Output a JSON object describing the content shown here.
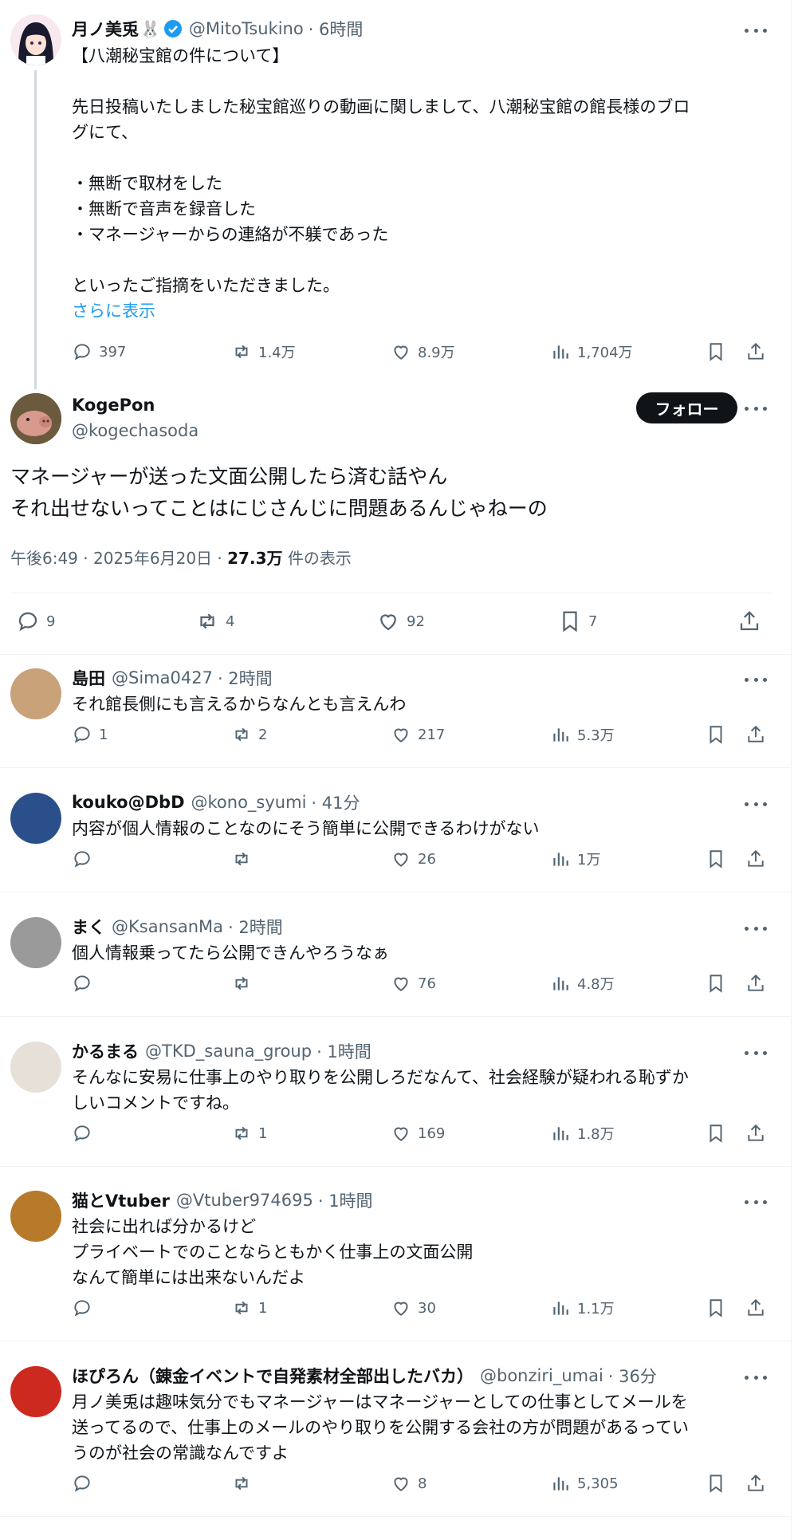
{
  "parent": {
    "name": "月ノ美兎",
    "handle": "@MitoTsukino",
    "time": "· 6時間",
    "lines": [
      "【八潮秘宝館の件について】",
      "",
      "先日投稿いたしました秘宝館巡りの動画に関しまして、八潮秘宝館の館長様のブロ",
      "グにて、",
      "",
      "・無断で取材をした",
      "・無断で音声を録音した",
      "・マネージャーからの連絡が不躾であった",
      "",
      "といったご指摘をいただきました。"
    ],
    "show_more": "さらに表示",
    "stats": {
      "replies": "397",
      "retweets": "1.4万",
      "likes": "8.9万",
      "views": "1,704万"
    }
  },
  "main": {
    "name": "KogePon",
    "handle": "@kogechasoda",
    "follow_label": "フォロー",
    "line1": "マネージャーが送った文面公開したら済む話やん",
    "line2": "それ出せないってことはにじさんじに問題あるんじゃねーの",
    "time": "午後6:49 · 2025年6月20日 · ",
    "views_count": "27.3万",
    "views_label": " 件の表示",
    "stats": {
      "replies": "9",
      "retweets": "4",
      "likes": "92",
      "bookmarks": "7"
    }
  },
  "replies": [
    {
      "name": "島田",
      "handle": "@Sima0427",
      "time": "· 2時間",
      "text": "それ館長側にも言えるからなんとも言えんわ",
      "replies": "1",
      "retweets": "2",
      "likes": "217",
      "views": "5.3万"
    },
    {
      "name": "kouko@DbD",
      "handle": "@kono_syumi",
      "time": "· 41分",
      "text": "内容が個人情報のことなのにそう簡単に公開できるわけがない",
      "replies": "",
      "retweets": "",
      "likes": "26",
      "views": "1万"
    },
    {
      "name": "まく",
      "handle": "@KsansanMa",
      "time": "· 2時間",
      "text": "個人情報乗ってたら公開できんやろうなぁ",
      "replies": "",
      "retweets": "",
      "likes": "76",
      "views": "4.8万"
    },
    {
      "name": "かるまる",
      "handle": "@TKD_sauna_group",
      "time": "· 1時間",
      "text": "そんなに安易に仕事上のやり取りを公開しろだなんて、社会経験が疑われる恥ずか\nしいコメントですね。",
      "replies": "",
      "retweets": "1",
      "likes": "169",
      "views": "1.8万"
    },
    {
      "name": "猫とVtuber",
      "handle": "@Vtuber974695",
      "time": "· 1時間",
      "text": "社会に出れば分かるけど\nプライベートでのことならともかく仕事上の文面公開\nなんて簡単には出来ないんだよ",
      "replies": "",
      "retweets": "1",
      "likes": "30",
      "views": "1.1万"
    },
    {
      "name": "ほぴろん（錬金イベントで自発素材全部出したバカ）",
      "handle": "@bonziri_umai",
      "time": "· 36分",
      "text": "月ノ美兎は趣味気分でもマネージャーはマネージャーとしての仕事としてメールを\n送ってるので、仕事上のメールのやり取りを公開する会社の方が問題があるってい\nうのが社会の常識なんですよ",
      "replies": "",
      "retweets": "",
      "likes": "8",
      "views": "5,305"
    }
  ],
  "colors": {
    "accent": "#1d9bf0",
    "text": "#0f1419",
    "muted": "#536471",
    "border": "#eff3f4"
  }
}
